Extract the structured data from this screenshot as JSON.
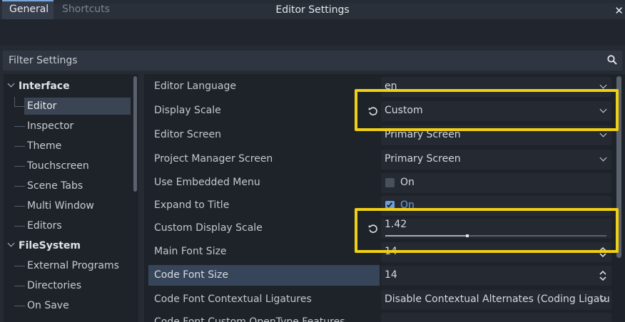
{
  "window": {
    "title": "Editor Settings"
  },
  "tabs": [
    {
      "label": "General"
    },
    {
      "label": "Shortcuts"
    }
  ],
  "filter": {
    "placeholder": "Filter Settings"
  },
  "tree": {
    "items": [
      {
        "label": "Interface",
        "type": "section"
      },
      {
        "label": "Editor",
        "type": "item",
        "selected": true
      },
      {
        "label": "Inspector",
        "type": "item"
      },
      {
        "label": "Theme",
        "type": "item"
      },
      {
        "label": "Touchscreen",
        "type": "item"
      },
      {
        "label": "Scene Tabs",
        "type": "item"
      },
      {
        "label": "Multi Window",
        "type": "item"
      },
      {
        "label": "Editors",
        "type": "item"
      },
      {
        "label": "FileSystem",
        "type": "section"
      },
      {
        "label": "External Programs",
        "type": "item"
      },
      {
        "label": "Directories",
        "type": "item"
      },
      {
        "label": "On Save",
        "type": "item"
      }
    ]
  },
  "settings": [
    {
      "label": "Editor Language",
      "value": "en",
      "control": "dropdown"
    },
    {
      "label": "Display Scale",
      "value": "Custom",
      "control": "dropdown",
      "reset": true
    },
    {
      "label": "Editor Screen",
      "value": "Primary Screen",
      "control": "dropdown"
    },
    {
      "label": "Project Manager Screen",
      "value": "Primary Screen",
      "control": "dropdown"
    },
    {
      "label": "Use Embedded Menu",
      "value": "On",
      "control": "checkbox",
      "checked": false
    },
    {
      "label": "Expand to Title",
      "value": "On",
      "control": "checkbox",
      "checked": true
    },
    {
      "label": "Custom Display Scale",
      "value": "1.42",
      "control": "slider",
      "reset": true,
      "slider_fraction": 0.37
    },
    {
      "label": "Main Font Size",
      "value": "14",
      "control": "spinbox"
    },
    {
      "label": "Code Font Size",
      "value": "14",
      "control": "spinbox",
      "highlighted": true
    },
    {
      "label": "Code Font Contextual Ligatures",
      "value": "Disable Contextual Alternates (Coding Ligatu",
      "control": "dropdown"
    },
    {
      "label": "Code Font Custom OpenType Features",
      "value": "",
      "control": "text"
    }
  ],
  "colors": {
    "highlight_box": "#f1d013",
    "accent": "#6e9fd8",
    "selected_row": "#37455a"
  },
  "icons": {
    "search": "search-icon",
    "reset": "reset-icon",
    "close": "close-icon"
  }
}
